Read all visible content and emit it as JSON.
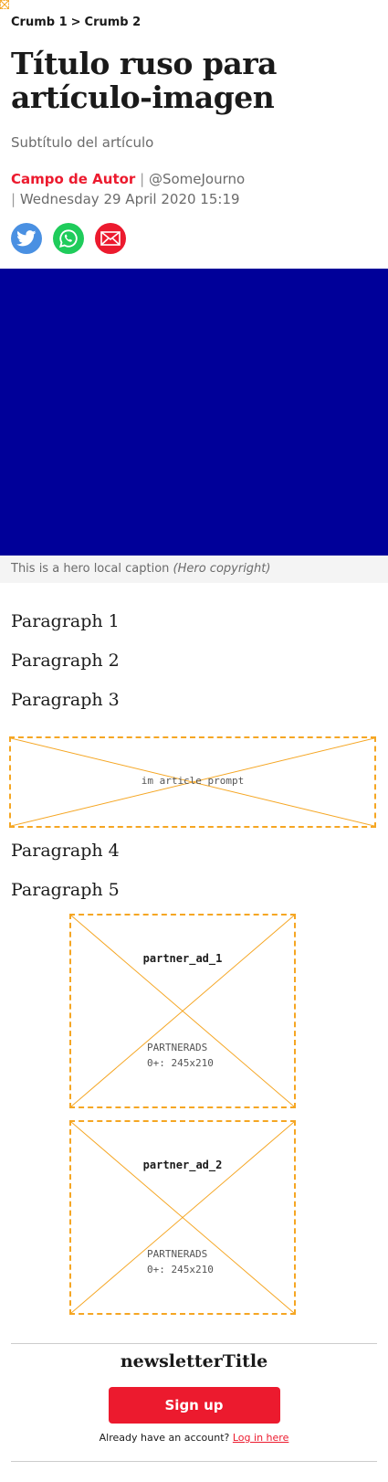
{
  "breadcrumb": {
    "items": [
      "Crumb 1",
      "Crumb 2"
    ],
    "separator": ">"
  },
  "article": {
    "title": "Título ruso para artículo-imagen",
    "subtitle": "Subtítulo del artículo",
    "author": "Campo de Autor",
    "handle": "@SomeJourno",
    "date": "Wednesday 29 April 2020 15:19",
    "separator": "|"
  },
  "share": {
    "icons": [
      "twitter-icon",
      "whatsapp-icon",
      "email-icon"
    ],
    "colors": {
      "twitter": "#4a90e2",
      "whatsapp": "#1fcc5b",
      "email": "#ec1a2e"
    }
  },
  "hero": {
    "color": "#000099",
    "caption": "This is a hero local caption",
    "copyright": "(Hero copyright)"
  },
  "paragraphs": [
    "Paragraph 1",
    "Paragraph 2",
    "Paragraph 3",
    "Paragraph 4",
    "Paragraph 5"
  ],
  "prompt_placeholder": {
    "label": "im article prompt"
  },
  "ads": [
    {
      "name": "partner_ad_1",
      "line1": "PARTNERADS",
      "line2": "0+: 245x210"
    },
    {
      "name": "partner_ad_2",
      "line1": "PARTNERADS",
      "line2": "0+: 245x210"
    }
  ],
  "newsletter": {
    "title": "newsletterTitle",
    "button": "Sign up",
    "account_text": "Already have an account?",
    "login_link": "Log in here"
  },
  "colors": {
    "accent": "#ec1a2e",
    "placeholder_border": "#f5a623"
  }
}
